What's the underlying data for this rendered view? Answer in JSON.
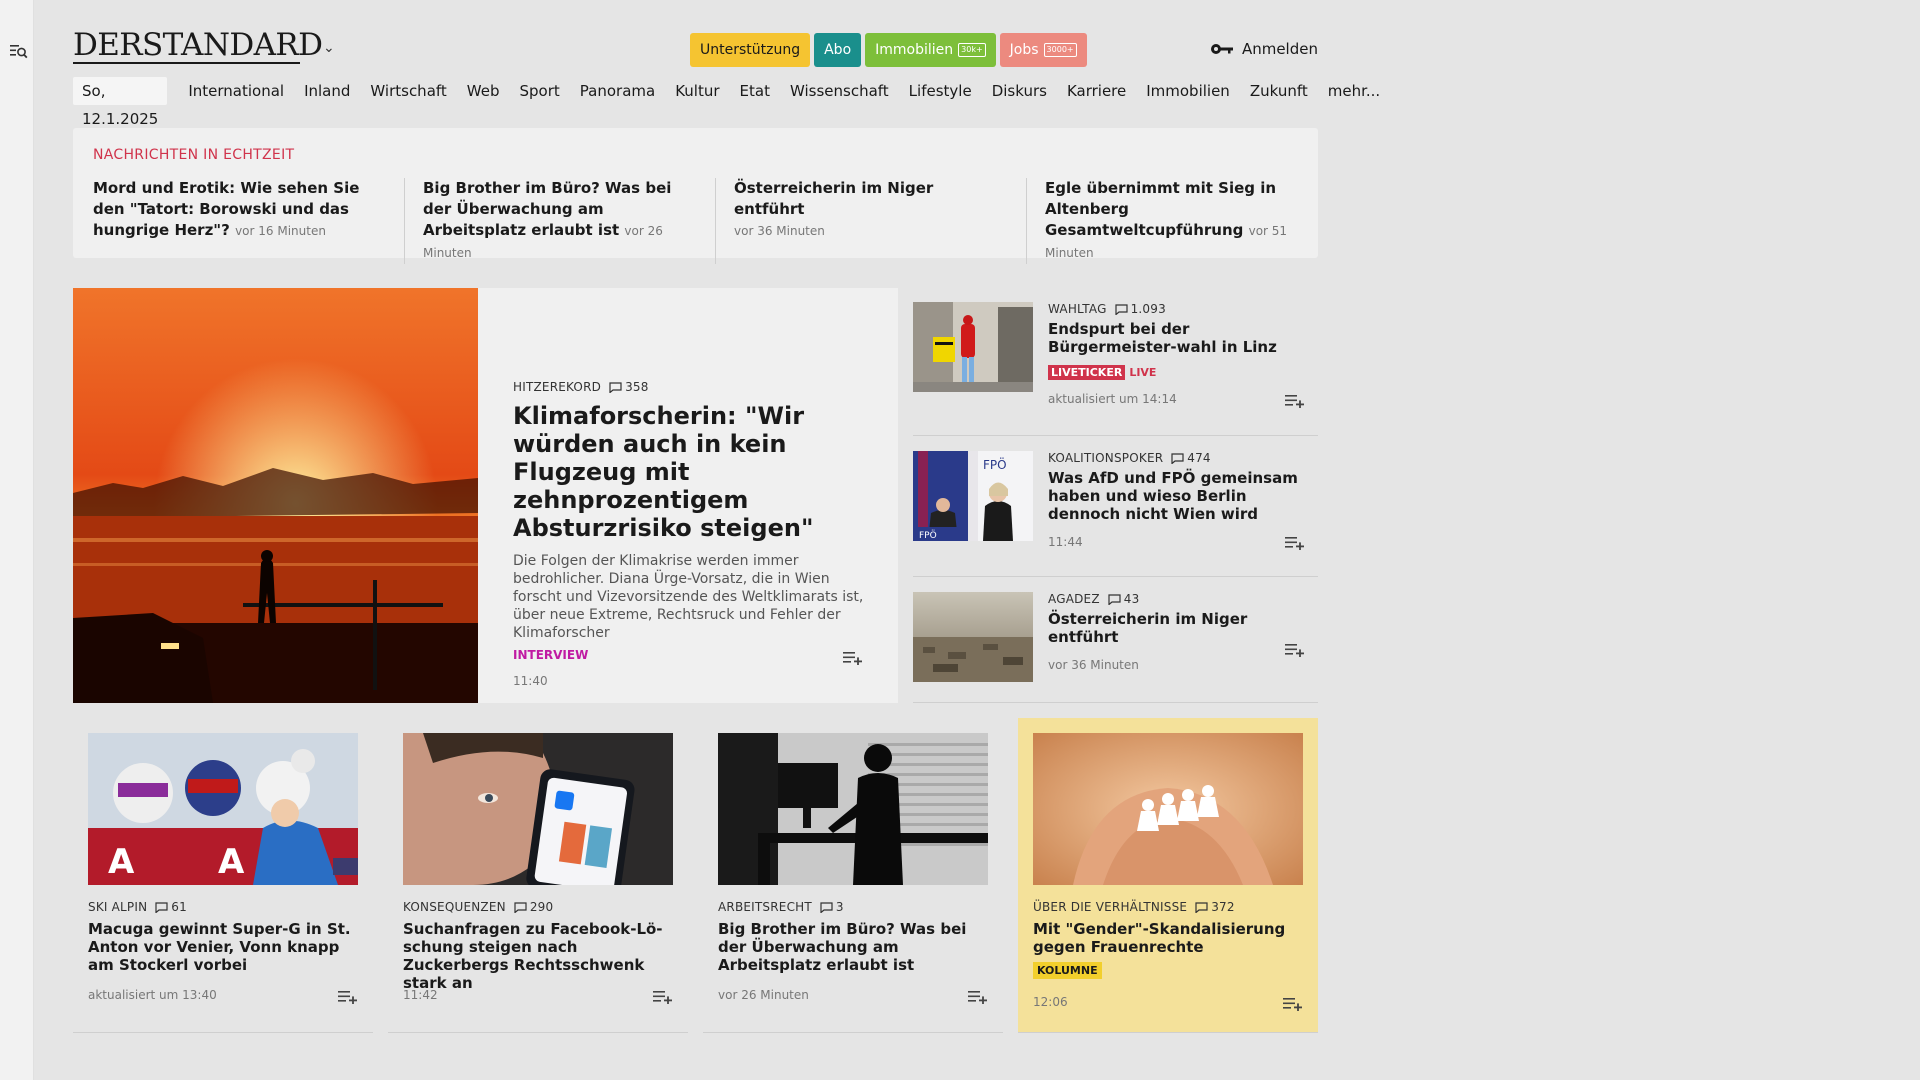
{
  "logo": "DERSTANDARD",
  "topbar": {
    "pills": [
      {
        "label": "Unterstützung",
        "count": "",
        "bg": "#f5c431",
        "fg": "#1a1a1a"
      },
      {
        "label": "Abo",
        "count": "",
        "bg": "#1a8f8c",
        "fg": "#ffffff"
      },
      {
        "label": "Immobilien",
        "count": "30k+",
        "bg": "#7dbf3a",
        "fg": "#ffffff"
      },
      {
        "label": "Jobs",
        "count": "3000+",
        "bg": "#ec8a7f",
        "fg": "#ffffff"
      }
    ],
    "login": "Anmelden"
  },
  "nav": {
    "date": "So, 12.1.2025",
    "items": [
      "International",
      "Inland",
      "Wirtschaft",
      "Web",
      "Sport",
      "Panorama",
      "Kultur",
      "Etat",
      "Wissenschaft",
      "Lifestyle",
      "Diskurs",
      "Karriere",
      "Immobilien",
      "Zukunft",
      "mehr..."
    ]
  },
  "ticker": {
    "heading": "NACHRICHTEN IN ECHTZEIT",
    "items": [
      {
        "title": "Mord und Erotik: Wie sehen Sie den \"Tatort: Borowski und das hungrige Herz\"?",
        "ago": "vor 16 Minuten"
      },
      {
        "title": "Big Brother im Büro? Was bei der Überwachung am Arbeitsplatz erlaubt ist",
        "ago": "vor 26 Minuten"
      },
      {
        "title": "Österreicherin im Niger entführt",
        "ago": "vor 36 Minuten"
      },
      {
        "title": "Egle übernimmt mit Sieg in Altenberg Gesamtweltcupführung",
        "ago": "vor 51 Minuten"
      }
    ]
  },
  "hero": {
    "kicker": "HITZEREKORD",
    "comments": "358",
    "title": "Klimaforscherin: \"Wir würden auch in kein Flugzeug mit zehnprozentigem Absturzrisiko steigen\"",
    "lead": "Die Folgen der Klimakrise werden immer bedrohlicher. Diana Ürge-Vorsatz, die in Wien forscht und Vizevorsitzende des Weltklimarats ist, über neue Extreme, Rechtsruck und Fehler der Klimaforscher",
    "tag": "INTERVIEW",
    "time": "11:40"
  },
  "side": [
    {
      "kicker": "WAHLTAG",
      "comments": "1.093",
      "title": "Endspurt bei der Bürgermeister-wahl in Linz",
      "liveticker": "LIVETICKER",
      "live": "LIVE",
      "time": "aktualisiert um 14:14"
    },
    {
      "kicker": "KOALITIONSPOKER",
      "comments": "474",
      "title": "Was AfD und FPÖ gemeinsam haben und wieso Berlin dennoch nicht Wien wird",
      "time": "11:44"
    },
    {
      "kicker": "AGADEZ",
      "comments": "43",
      "title": "Österreicherin im Niger entführt",
      "time": "vor 36 Minuten"
    }
  ],
  "cards": [
    {
      "kicker": "SKI ALPIN",
      "comments": "61",
      "title": "Macuga gewinnt Super-G in St. Anton vor Venier, Vonn knapp am Stockerl vorbei",
      "time": "aktualisiert um 13:40"
    },
    {
      "kicker": "KONSEQUENZEN",
      "comments": "290",
      "title": "Suchanfragen zu Facebook-Lö-schung steigen nach Zuckerbergs Rechtsschwenk stark an",
      "time": "11:42"
    },
    {
      "kicker": "ARBEITSRECHT",
      "comments": "3",
      "title": "Big Brother im Büro? Was bei der Überwachung am Arbeitsplatz erlaubt ist",
      "time": "vor 26 Minuten"
    },
    {
      "kicker": "ÜBER DIE VERHÄLTNISSE",
      "comments": "372",
      "title": "Mit \"Gender\"-Skandalisierung gegen Frauenrechte",
      "tag": "KOLUMNE",
      "time": "12:06"
    }
  ]
}
